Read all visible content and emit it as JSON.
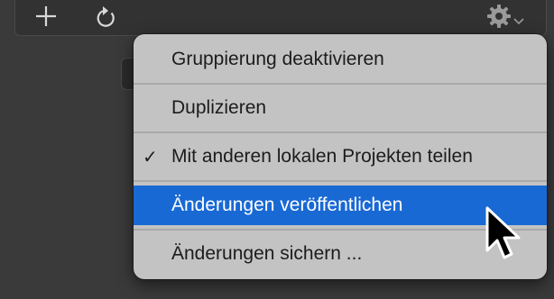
{
  "toolbar": {
    "add_icon": "plus-icon",
    "refresh_icon": "refresh-icon",
    "settings_icon": "gear-icon"
  },
  "menu": {
    "items": [
      {
        "label": "Gruppierung deaktivieren",
        "checked": false,
        "highlighted": false
      },
      {
        "label": "Duplizieren",
        "checked": false,
        "highlighted": false
      },
      {
        "label": "Mit anderen lokalen Projekten teilen",
        "checked": true,
        "highlighted": false,
        "check_mark": "✓"
      },
      {
        "label": "Änderungen veröffentlichen",
        "checked": false,
        "highlighted": true
      },
      {
        "label": "Änderungen sichern ...",
        "checked": false,
        "highlighted": false
      }
    ]
  },
  "colors": {
    "highlight": "#1969d4",
    "menu_bg": "#c3c3c3",
    "window_bg": "#3a3a3b"
  }
}
